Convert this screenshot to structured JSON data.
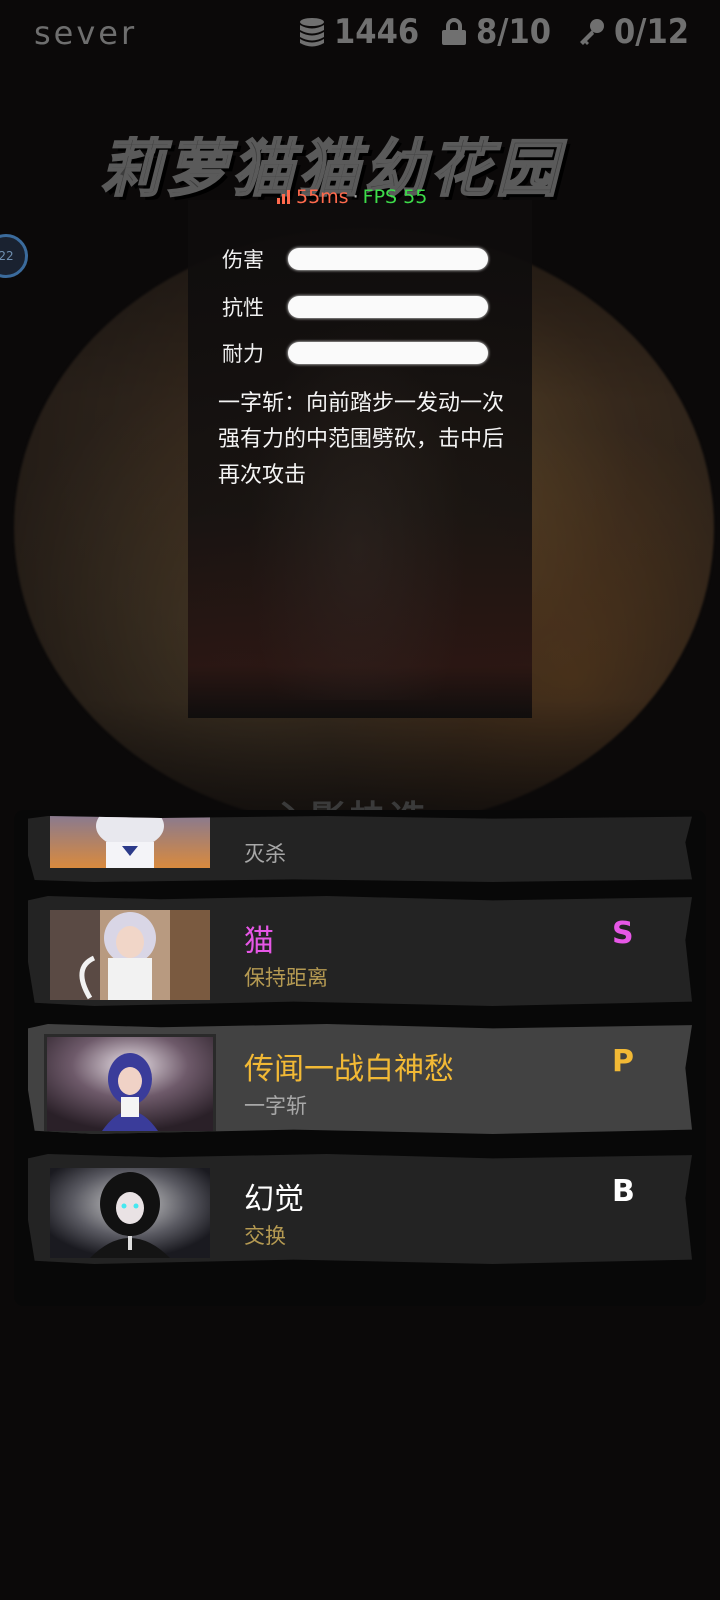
{
  "topbar": {
    "server": "sever",
    "coins": "1446",
    "lock": "8/10",
    "keys": "0/12"
  },
  "title": "莉萝猫猫幼花园",
  "network": {
    "ping": "55ms",
    "separator": "·",
    "fps": "FPS 55"
  },
  "left_badge": "22",
  "info_panel": {
    "stats": [
      {
        "label": "伤害"
      },
      {
        "label": "抗性"
      },
      {
        "label": "耐力"
      }
    ],
    "description": "一字斩：向前踏步一发动一次强有力的中范围劈砍，击中后再次攻击"
  },
  "section_title": "心影抉选",
  "characters": [
    {
      "name": "",
      "skill": "灭杀",
      "rank": "",
      "name_color": "#ffffff",
      "skill_color": "#a8a8a8"
    },
    {
      "name": "猫",
      "skill": "保持距离",
      "rank": "S",
      "name_color": "#e657e6",
      "skill_color": "#b59a52"
    },
    {
      "name": "传闻一战白神愁",
      "skill": "一字斩",
      "rank": "P",
      "name_color": "#f2b935",
      "skill_color": "#a8a8a8",
      "selected": true
    },
    {
      "name": "幻觉",
      "skill": "交换",
      "rank": "B",
      "name_color": "#ffffff",
      "skill_color": "#b59a52"
    }
  ],
  "icons": {
    "coins": "coin-stack-icon",
    "lock": "lock-icon",
    "key": "key-icon",
    "signal": "signal-icon"
  }
}
